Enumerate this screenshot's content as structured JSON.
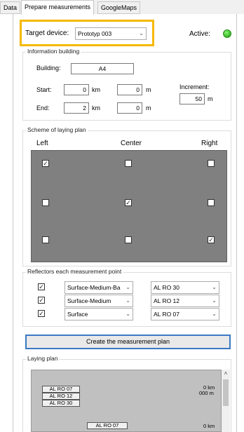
{
  "tabs": [
    {
      "label": "Data"
    },
    {
      "label": "Prepare measurements"
    },
    {
      "label": "GoogleMaps"
    }
  ],
  "target": {
    "label": "Target device:",
    "value": "Prototyp 003",
    "active_label": "Active:",
    "active_color": "#3fbf2a"
  },
  "info": {
    "title": "Information building",
    "building_label": "Building:",
    "building_value": "A4",
    "start_label": "Start:",
    "start_km": "0",
    "start_m": "0",
    "end_label": "End:",
    "end_km": "2",
    "end_m": "0",
    "unit_km": "km",
    "unit_m": "m",
    "increment_label": "Increment:",
    "increment_value": "50",
    "increment_unit": "m"
  },
  "scheme": {
    "title": "Scheme of laying plan",
    "left": "Left",
    "center": "Center",
    "right": "Right",
    "grid": [
      [
        true,
        false,
        false
      ],
      [
        false,
        true,
        false
      ],
      [
        false,
        false,
        true
      ]
    ]
  },
  "reflectors": {
    "title": "Reflectors each measurement point",
    "rows": [
      {
        "checked": true,
        "surface": "Surface-Medium-Ba",
        "reflector": "AL RO 30"
      },
      {
        "checked": true,
        "surface": "Surface-Medium",
        "reflector": "AL RO 12"
      },
      {
        "checked": true,
        "surface": "Surface",
        "reflector": "AL RO 07"
      }
    ]
  },
  "create_button": "Create the measurement plan",
  "laying": {
    "title": "Laying plan",
    "stack": [
      "AL RO 07",
      "AL RO 12",
      "AL RO 30"
    ],
    "marker1_km": "0 km",
    "marker1_m": "000 m",
    "bottom_box": "AL RO 07",
    "marker2_km": "0 km"
  }
}
